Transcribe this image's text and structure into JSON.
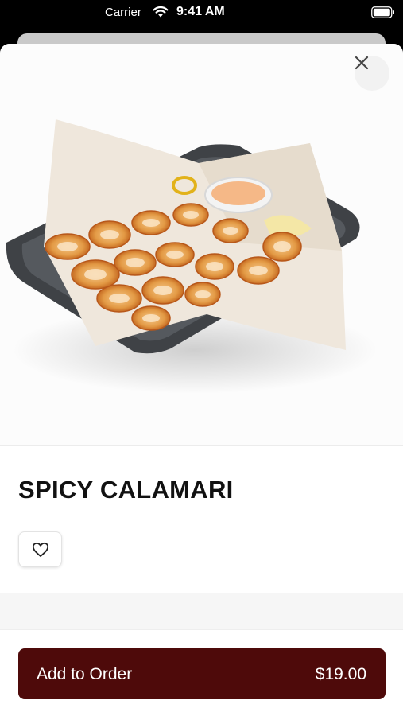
{
  "status_bar": {
    "carrier": "Carrier",
    "time": "9:41 AM"
  },
  "item": {
    "title": "SPICY CALAMARI",
    "image": "spicy calamari basket with dipping sauce"
  },
  "actions": {
    "add_label": "Add to Order",
    "price": "$19.00"
  },
  "icons": {
    "close": "close-icon",
    "favorite": "heart-outline-icon",
    "wifi": "wifi-icon",
    "battery": "battery-icon"
  },
  "colors": {
    "button": "#4e0a0a",
    "sheet": "#ffffff"
  }
}
